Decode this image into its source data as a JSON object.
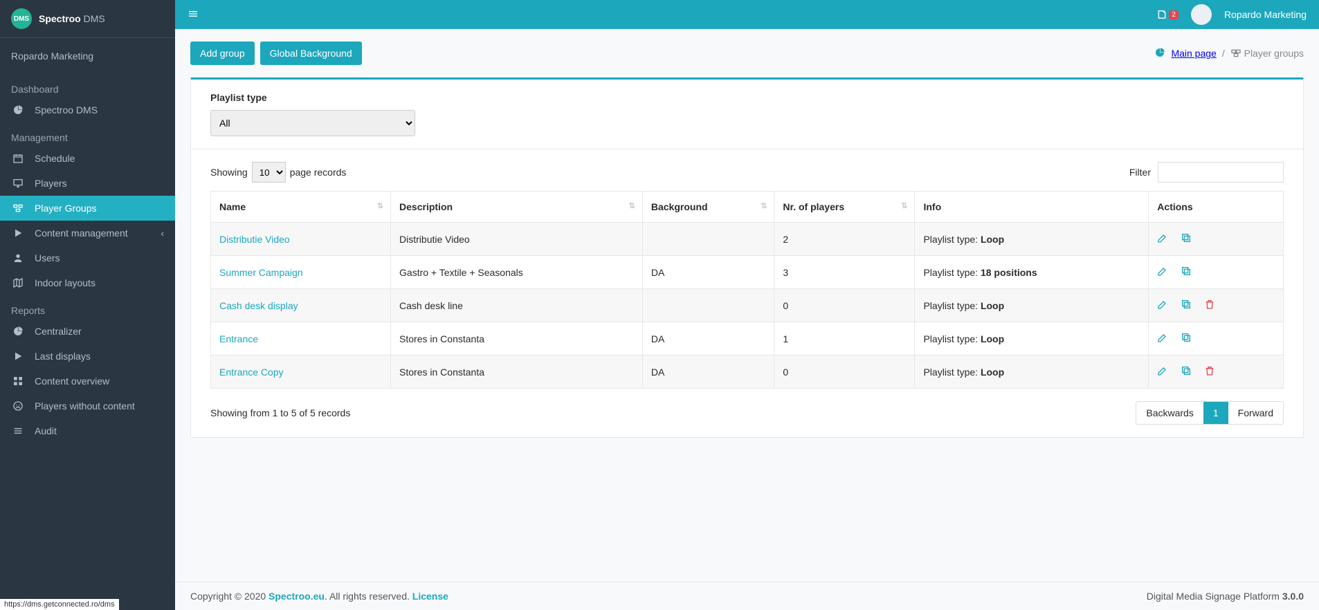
{
  "brand": {
    "logo_text": "DMS",
    "name_bold": "Spectroo",
    "name_thin": " DMS"
  },
  "org": "Ropardo Marketing",
  "sidebar": {
    "sections": [
      {
        "title": "Dashboard",
        "items": [
          {
            "id": "spectroo-dms",
            "label": "Spectroo DMS",
            "icon": "pie"
          }
        ]
      },
      {
        "title": "Management",
        "items": [
          {
            "id": "schedule",
            "label": "Schedule",
            "icon": "calendar"
          },
          {
            "id": "players",
            "label": "Players",
            "icon": "monitor"
          },
          {
            "id": "player-groups",
            "label": "Player Groups",
            "icon": "groups",
            "active": true
          },
          {
            "id": "content-management",
            "label": "Content management",
            "icon": "play",
            "chevron": true
          },
          {
            "id": "users",
            "label": "Users",
            "icon": "user"
          },
          {
            "id": "indoor-layouts",
            "label": "Indoor layouts",
            "icon": "map"
          }
        ]
      },
      {
        "title": "Reports",
        "items": [
          {
            "id": "centralizer",
            "label": "Centralizer",
            "icon": "pie"
          },
          {
            "id": "last-displays",
            "label": "Last displays",
            "icon": "play"
          },
          {
            "id": "content-overview",
            "label": "Content overview",
            "icon": "grid"
          },
          {
            "id": "players-no-content",
            "label": "Players without content",
            "icon": "sad"
          },
          {
            "id": "audit",
            "label": "Audit",
            "icon": "list"
          }
        ]
      }
    ]
  },
  "status_url": "https://dms.getconnected.ro/dms",
  "topbar": {
    "notif_count": "2",
    "user": "Ropardo Marketing"
  },
  "actions": {
    "add_group": "Add group",
    "global_bg": "Global Background"
  },
  "breadcrumb": {
    "main": "Main page",
    "current": "Player groups",
    "sep": "/"
  },
  "filter_panel": {
    "label": "Playlist type",
    "selected": "All"
  },
  "table_controls": {
    "showing": "Showing",
    "page_records": "page records",
    "page_size": "10",
    "filter_label": "Filter"
  },
  "columns": [
    "Name",
    "Description",
    "Background",
    "Nr. of players",
    "Info",
    "Actions"
  ],
  "info_prefix": "Playlist type: ",
  "rows": [
    {
      "name": "Distributie Video",
      "desc": "Distributie Video",
      "bg": "",
      "nr": "2",
      "info": "Loop",
      "del": false
    },
    {
      "name": "Summer Campaign",
      "desc": "Gastro + Textile + Seasonals",
      "bg": "DA",
      "nr": "3",
      "info": "18 positions",
      "del": false
    },
    {
      "name": "Cash desk display",
      "desc": "Cash desk line",
      "bg": "",
      "nr": "0",
      "info": "Loop",
      "del": true
    },
    {
      "name": "Entrance",
      "desc": "Stores in Constanta",
      "bg": "DA",
      "nr": "1",
      "info": "Loop",
      "del": false
    },
    {
      "name": "Entrance Copy",
      "desc": "Stores in Constanta",
      "bg": "DA",
      "nr": "0",
      "info": "Loop",
      "del": true
    }
  ],
  "table_footer": "Showing from 1 to 5 of 5 records",
  "pager": {
    "back": "Backwards",
    "page": "1",
    "fwd": "Forward"
  },
  "footer": {
    "copyright": "Copyright © 2020 ",
    "brand": "Spectroo.eu",
    "rights": ". All rights reserved. ",
    "license": "License",
    "platform": "Digital Media Signage Platform ",
    "version": "3.0.0"
  }
}
